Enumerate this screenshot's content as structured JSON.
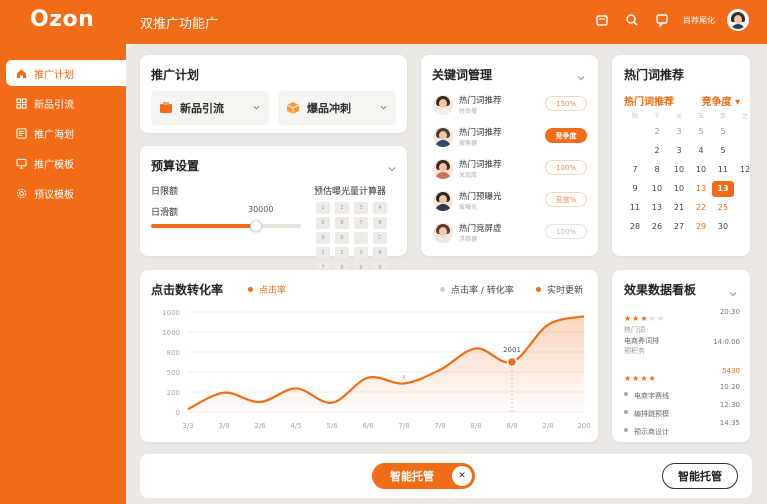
{
  "app": {
    "logo": "Ozon",
    "title": "双推广功能广",
    "user_name": "尚荐尾化"
  },
  "colors": {
    "brand": "#f26b16",
    "brand_light": "#fde3d1"
  },
  "top_icons": [
    "store-icon",
    "search-icon",
    "message-icon"
  ],
  "sidebar": {
    "items": [
      {
        "label": "推广计划",
        "icon": "home-icon",
        "active": true
      },
      {
        "label": "新品引流",
        "icon": "grid-icon",
        "active": false
      },
      {
        "label": "推广海划",
        "icon": "list-icon",
        "active": false
      },
      {
        "label": "推广模板",
        "icon": "monitor-icon",
        "active": false
      },
      {
        "label": "预议模板",
        "icon": "gear-icon",
        "active": false
      }
    ]
  },
  "plan": {
    "title": "推广计划",
    "options": [
      {
        "label": "新品引流",
        "icon": "cart-icon"
      },
      {
        "label": "爆品冲刺",
        "icon": "box-icon"
      }
    ]
  },
  "budget": {
    "title": "预算设置",
    "daily_label": "日限额",
    "slider_label": "日滑额",
    "slider_value": "30000",
    "slider_fraction": 0.7,
    "calc_label": "预估曝光量计算器",
    "keys": [
      "1",
      "2",
      "3",
      "4",
      "5",
      "6",
      "7",
      "8",
      "9",
      "0",
      "·",
      "C",
      "1",
      "2",
      "3",
      "4",
      "7",
      "8",
      "9",
      "0"
    ]
  },
  "keywords": {
    "title": "关键词管理",
    "rows": [
      {
        "name": "热门词推荐",
        "sub": "时尚搜",
        "badge": "150%",
        "style": "outline",
        "hair": "#3b2a1f",
        "body": "#f0f0f0"
      },
      {
        "name": "热门词推荐",
        "sub": "搜索器",
        "badge": "竞争度",
        "style": "on",
        "hair": "#4b3a2f",
        "body": "#2b4a6f"
      },
      {
        "name": "热门词推荐",
        "sub": "关现库",
        "badge": "100%",
        "style": "outline",
        "hair": "#3a2a22",
        "body": "#c9735a"
      },
      {
        "name": "热门预曝光",
        "sub": "爱曝光",
        "badge": "竞旅%",
        "style": "outline",
        "hair": "#2a2a2a",
        "body": "#2b3a4f"
      },
      {
        "name": "热门竞屏虚",
        "sub": "浮移器",
        "badge": "100%",
        "style": "gray",
        "hair": "#5a3a2a",
        "body": "#e8e8e8"
      }
    ]
  },
  "hot": {
    "title": "热门词推荐",
    "sub_title": "热门词推荐",
    "selector": "竞争度",
    "dow": [
      "阳",
      "千",
      "元",
      "五",
      "京",
      "之"
    ],
    "days": [
      {
        "t": "",
        "c": ""
      },
      {
        "t": "2",
        "c": "muted"
      },
      {
        "t": "3",
        "c": "muted"
      },
      {
        "t": "5",
        "c": "muted"
      },
      {
        "t": "5",
        "c": "muted"
      },
      {
        "t": "",
        "c": ""
      },
      {
        "t": "",
        "c": ""
      },
      {
        "t": "2",
        "c": ""
      },
      {
        "t": "3",
        "c": ""
      },
      {
        "t": "4",
        "c": ""
      },
      {
        "t": "5",
        "c": ""
      },
      {
        "t": "",
        "c": ""
      },
      {
        "t": "7",
        "c": ""
      },
      {
        "t": "8",
        "c": ""
      },
      {
        "t": "10",
        "c": ""
      },
      {
        "t": "10",
        "c": ""
      },
      {
        "t": "11",
        "c": ""
      },
      {
        "t": "12",
        "c": ""
      },
      {
        "t": "9",
        "c": ""
      },
      {
        "t": "10",
        "c": ""
      },
      {
        "t": "10",
        "c": ""
      },
      {
        "t": "13",
        "c": "hl"
      },
      {
        "t": "13",
        "c": "today"
      },
      {
        "t": "",
        "c": ""
      },
      {
        "t": "11",
        "c": ""
      },
      {
        "t": "13",
        "c": ""
      },
      {
        "t": "21",
        "c": ""
      },
      {
        "t": "22",
        "c": "hl"
      },
      {
        "t": "25",
        "c": "hl"
      },
      {
        "t": "",
        "c": ""
      },
      {
        "t": "28",
        "c": ""
      },
      {
        "t": "26",
        "c": ""
      },
      {
        "t": "27",
        "c": ""
      },
      {
        "t": "29",
        "c": "hl"
      },
      {
        "t": "30",
        "c": ""
      },
      {
        "t": "",
        "c": ""
      }
    ]
  },
  "chart_section": {
    "title": "点击数转化率",
    "legend_main": "点击率",
    "legend_rate": "点击率 / 转化率",
    "legend_live": "实时更新"
  },
  "chart_data": {
    "type": "area",
    "title": "点击数转化率",
    "x": [
      "3/3",
      "3/8",
      "2/6",
      "4/5",
      "5/6",
      "6/6",
      "7/8",
      "7/8",
      "8/8",
      "8/8",
      "2/8",
      "200"
    ],
    "y_ticks": [
      0,
      200,
      500,
      800,
      1000,
      1000
    ],
    "series": [
      {
        "name": "点击率",
        "values": [
          40,
          270,
          140,
          330,
          130,
          480,
          400,
          590,
          890,
          700,
          1220,
          1340
        ]
      }
    ],
    "ylim": [
      0,
      1400
    ],
    "annotations": [
      {
        "label": "2001",
        "index": 9
      },
      {
        "label": "X",
        "index": 6
      }
    ],
    "grid": true
  },
  "effect": {
    "title": "效果数据看板",
    "top": [
      {
        "stars": 3,
        "label": "热门词",
        "value": "20:30"
      },
      {
        "stars": 0,
        "label": "电商养词排",
        "sub": "预积务",
        "value": "14:0.00"
      }
    ],
    "highlight": {
      "stars": 4,
      "value": "5430"
    },
    "list": [
      {
        "label": "电商字赛线",
        "value": "10:20"
      },
      {
        "label": "编排跳预模",
        "value": "12:30"
      },
      {
        "label": "预示商设计",
        "value": "14:35"
      }
    ]
  },
  "bottom": {
    "smart_button": "智能托管",
    "close_symbol": "✕",
    "smart_button_right": "智能托管"
  }
}
